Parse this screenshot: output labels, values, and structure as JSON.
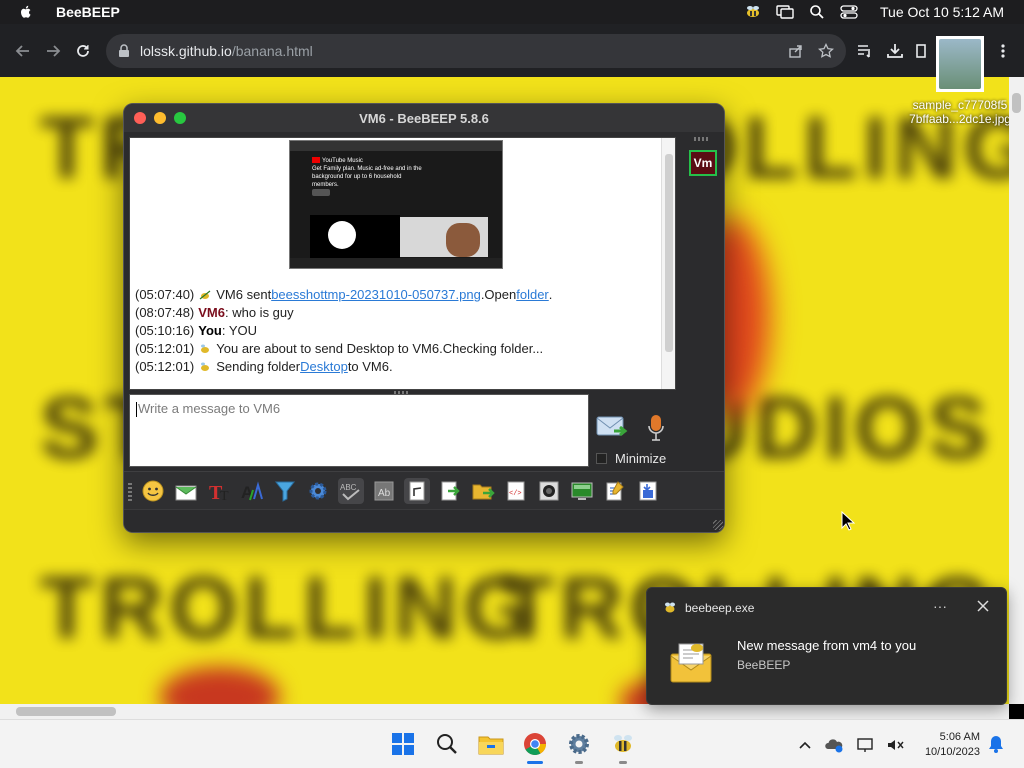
{
  "macbar": {
    "app_name": "BeeBEEP",
    "clock": "Tue Oct 10  5:12 AM"
  },
  "browser": {
    "url_host": "lolssk.github.io",
    "url_path": "/banana.html"
  },
  "page": {
    "words": [
      "TROLLING",
      "TROLLING",
      "TROLLING",
      "TROLLING",
      "STUDIOS",
      "STUDIOS",
      "TROLLING",
      "TROLLING"
    ]
  },
  "desktop_file": {
    "name_line1": "sample_c77708f5",
    "name_line2": "7bffaab...2dc1e.jpg"
  },
  "beebeep": {
    "title": "VM6 - BeeBEEP 5.8.6",
    "avatar": "Vm",
    "preview": {
      "yt_line1": "YouTube Music",
      "yt_line2": "Get Family plan. Music ad-free and in the background for up to 6 household members."
    },
    "messages": [
      {
        "ts": "(05:07:40)",
        "pre": "VM6 sent ",
        "link1": "beesshottmp-20231010-050737.png",
        "mid": ".Open ",
        "link2": "folder",
        "post": "."
      },
      {
        "ts": "(08:07:48)",
        "sender": "VM6",
        "text": ": who is guy"
      },
      {
        "ts": "(05:10:16)",
        "sender": "You",
        "text": ": YOU"
      },
      {
        "ts": "(05:12:01)",
        "text": "You are about to send Desktop to VM6.Checking folder..."
      },
      {
        "ts": "(05:12:01)",
        "pre": "Sending folder ",
        "link1": "Desktop",
        "post": " to VM6."
      }
    ],
    "input_placeholder": "Write a message to VM6",
    "minimize_label": "Minimize"
  },
  "notification": {
    "app": "beebeep.exe",
    "more": "···",
    "line1": "New message from vm4 to you",
    "line2": "BeeBEEP"
  },
  "taskbar": {
    "time": "5:06 AM",
    "date": "10/10/2023"
  },
  "colors": {
    "page_bg": "#f2e21a",
    "link": "#2a7ad6",
    "avatar_border": "#25c04a",
    "avatar_bg": "#5a0d14"
  }
}
